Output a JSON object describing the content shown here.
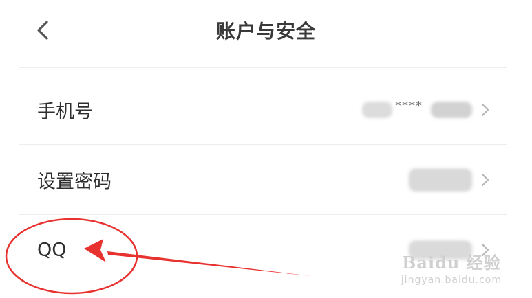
{
  "header": {
    "title": "账户与安全",
    "back_icon": "chevron-left-icon"
  },
  "rows": [
    {
      "label": "手机号",
      "value_visible": "****",
      "value_blurred": true,
      "chevron_icon": "chevron-right-icon"
    },
    {
      "label": "设置密码",
      "value_blurred": true,
      "chevron_icon": "chevron-right-icon"
    },
    {
      "label": "QQ",
      "value_blurred": true,
      "chevron_icon": "chevron-right-icon"
    }
  ],
  "annotation": {
    "color": "#e8322f",
    "shapes": [
      "ellipse",
      "arrow"
    ]
  },
  "watermark": {
    "brand": "Baidu 经验",
    "url": "jingyan.baidu.com"
  },
  "colors": {
    "background": "#ffffff",
    "divider": "#ededed",
    "text": "#2e2e2e",
    "chevron": "#b5b5b5"
  }
}
